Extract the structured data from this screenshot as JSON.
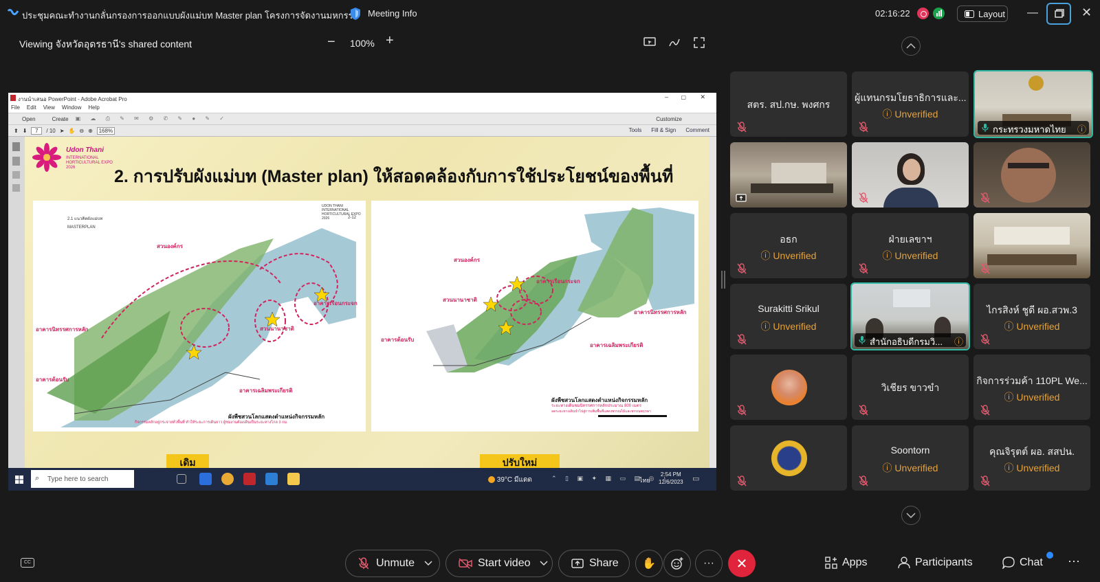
{
  "window": {
    "title": "ประชุมคณะทำงานกลั่นกรองการออกแบบผังแม่บท Master plan โครงการจัดงานมหกรรม...",
    "meeting_info": "Meeting Info",
    "clock": "02:16:22",
    "layout_label": "Layout"
  },
  "viewer": {
    "viewing_text": "Viewing จังหวัดอุดรธานี's shared content",
    "zoom": "100%"
  },
  "acrobat": {
    "title": "งานนำเสนอ PowerPoint - Adobe Acrobat Pro",
    "menu": [
      "File",
      "Edit",
      "View",
      "Window",
      "Help"
    ],
    "open": "Open",
    "create": "Create",
    "customize": "Customize",
    "page_current": "7",
    "page_total": "/ 10",
    "zoom": "168%",
    "tools": "Tools",
    "fill_sign": "Fill & Sign",
    "comment": "Comment"
  },
  "slide": {
    "logo_text": "Udon Thani",
    "logo_sub": "INTERNATIONAL HORTICULTURAL EXPO 2026",
    "title": "2. การปรับผังแม่บท (Master plan) ให้สอดคล้องกับการใช้ประโยชน์ของพื้นที่",
    "left_map": {
      "heading": "2.1 แนวคิดผังแม่บท",
      "sub": "MASTERPLAN",
      "expo": "UDON THANI INTERNATIONAL HORTICULTURAL EXPO 2026",
      "page": "2-12",
      "label_org": "สวนองค์กร",
      "label_main": "อาคารนิทรรศการหลัก",
      "label_intl": "สวนนานาชาติ",
      "label_greenhouse": "อาคารเรือนกระจก",
      "label_welcome": "อาคารต้อนรับ",
      "label_celebrate": "อาคารเฉลิมพระเกียรติ",
      "caption": "ผังพืชสวนโลกแสดงตำแหน่งกิจกรรมหลัก",
      "note": "กิจกรรมหลักอยู่กระจายทั่วพื้นที่ ทำให้ระยะการเดินยาว ผู้ชมงานต้องเดินเป็นระยะทางไกล 3 กม."
    },
    "right_map": {
      "label_org": "สวนองค์กร",
      "label_intl": "สวนนานาชาติ",
      "label_greenhouse": "อาคารเรือนกระจก",
      "label_main": "อาคารนิทรรศการหลัก",
      "label_welcome": "อาคารต้อนรับ",
      "label_celebrate": "อาคารเฉลิมพระเกียรติ",
      "caption": "ผังพืชสวนโลกแสดงตำแหน่งกิจกรรมหลัก",
      "note1": "ระยะทางเดินชมนิทรรศการหลักประมาณ 800 เมตร",
      "note2": "ลดระยะทางเดินนำไปสู่การเพิ่มพื้นที่แสดงพรรณไม้และพรรณพฤกษา"
    },
    "tab_left": "เดิม",
    "tab_right": "ปรับใหม่"
  },
  "taskbar": {
    "search": "Type here to search",
    "weather": "39°C มีแดด",
    "lang": "ไทย",
    "time": "2:54 PM",
    "date": "12/6/2023"
  },
  "participants": [
    {
      "name": "สตร. สป.กษ. พงศกร",
      "status": ""
    },
    {
      "name": "ผู้แทนกรมโยธาธิการและ...",
      "status": "Unverified"
    },
    {
      "name": "กระทรวงมหาดไทย",
      "status": ""
    },
    {
      "name": "",
      "status": ""
    },
    {
      "name": "",
      "status": ""
    },
    {
      "name": "",
      "status": ""
    },
    {
      "name": "อธก",
      "status": "Unverified"
    },
    {
      "name": "ฝ่ายเลขาฯ",
      "status": "Unverified"
    },
    {
      "name": "",
      "status": ""
    },
    {
      "name": "Surakitti Srikul",
      "status": "Unverified"
    },
    {
      "name": "สำนักอธิบดีกรมวิ...",
      "status": ""
    },
    {
      "name": "ไกรสิงห์ ชูดี ผอ.สวพ.3",
      "status": "Unverified"
    },
    {
      "name": "",
      "status": ""
    },
    {
      "name": "วิเชียร ขาวขำ",
      "status": ""
    },
    {
      "name": "กิจการร่วมค้า 110PL We...",
      "status": "Unverified"
    },
    {
      "name": "",
      "status": ""
    },
    {
      "name": "Soontorn",
      "status": "Unverified"
    },
    {
      "name": "คุณจิรุตต์ ผอ. สสปน.",
      "status": "Unverified"
    }
  ],
  "controls": {
    "unmute": "Unmute",
    "start_video": "Start video",
    "share": "Share",
    "apps": "Apps",
    "participants": "Participants",
    "chat": "Chat"
  },
  "colors": {
    "accent_active": "#2fb9a5",
    "unverified": "#e7a23a",
    "end_call": "#e0243b",
    "pink_label": "#d0245e"
  }
}
